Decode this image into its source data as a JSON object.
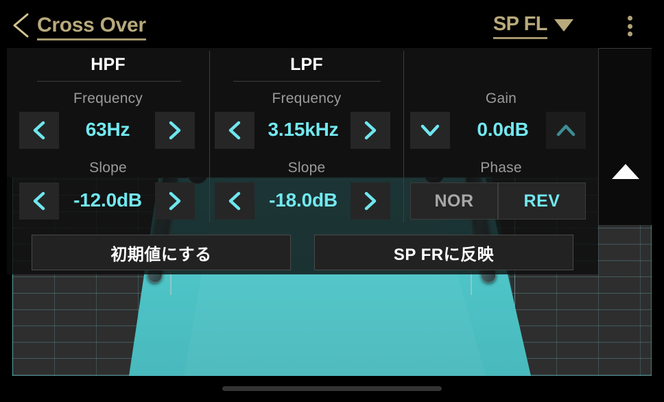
{
  "header": {
    "back_icon": "chevron-left-icon",
    "title": "Cross Over",
    "speaker_label": "SP FL",
    "speaker_caret_icon": "caret-down-icon",
    "menu_icon": "kebab-menu-icon",
    "accent_color": "#b8aa7c"
  },
  "panel": {
    "hpf": {
      "section_title": "HPF",
      "frequency_label": "Frequency",
      "frequency_value": "63Hz",
      "frequency_prev_icon": "chevron-left-icon",
      "frequency_next_icon": "chevron-right-icon",
      "slope_label": "Slope",
      "slope_value": "-12.0dB",
      "slope_prev_icon": "chevron-left-icon",
      "slope_next_icon": "chevron-right-icon"
    },
    "lpf": {
      "section_title": "LPF",
      "frequency_label": "Frequency",
      "frequency_value": "3.15kHz",
      "frequency_prev_icon": "chevron-left-icon",
      "frequency_next_icon": "chevron-right-icon",
      "slope_label": "Slope",
      "slope_value": "-18.0dB",
      "slope_prev_icon": "chevron-left-icon",
      "slope_next_icon": "chevron-right-icon"
    },
    "gain": {
      "gain_label": "Gain",
      "gain_value": "0.0dB",
      "gain_down_icon": "chevron-down-icon",
      "gain_up_icon": "chevron-up-icon",
      "phase_label": "Phase",
      "phase_nor": "NOR",
      "phase_rev": "REV",
      "phase_selected": "REV"
    },
    "value_color": "#72e8f0"
  },
  "actions": {
    "reset_label": "初期値にする",
    "apply_label": "SP FRに反映"
  },
  "right_column": {
    "collapse_icon": "triangle-up-icon"
  },
  "graph": {
    "fill_color": "#4ec5c8",
    "grid_color": "#78c8cd",
    "background_color": "#2e2e2e",
    "handle_left_icon": "drag-handle-icon",
    "handle_right_icon": "drag-handle-icon"
  },
  "system": {
    "home_indicator": "home-indicator"
  }
}
